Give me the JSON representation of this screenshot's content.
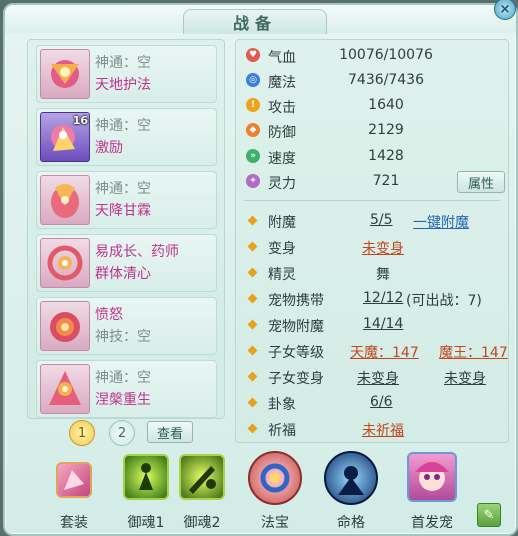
{
  "window": {
    "title": "战备",
    "close_label": "×",
    "colors": {
      "panel": "#dff1ec",
      "accent": "#e7a21a",
      "pink_text": "#c0338c",
      "red_text": "#c3461f",
      "blue_link": "#2267b3"
    }
  },
  "skills": [
    {
      "line1": "神通：空",
      "line2": "天地护法",
      "badge": "",
      "icon": "guardian-icon",
      "selected": false
    },
    {
      "line1": "神通：空",
      "line2": "激励",
      "badge": "16",
      "icon": "encourage-icon",
      "selected": true
    },
    {
      "line1": "神通：空",
      "line2": "天降甘霖",
      "badge": "",
      "icon": "rain-icon",
      "selected": false
    },
    {
      "line1": "易成长、药师",
      "line2": "群体清心",
      "badge": "",
      "icon": "cleanse-icon",
      "selected": false
    },
    {
      "line1": "愤怒",
      "line2": "神技：空",
      "badge": "",
      "icon": "rage-icon",
      "selected": false
    },
    {
      "line1": "神通：空",
      "line2": "涅槃重生",
      "badge": "",
      "icon": "rebirth-icon",
      "selected": false
    }
  ],
  "pagination": {
    "page1": "1",
    "page2": "2",
    "view_label": "查看"
  },
  "stats": [
    {
      "label": "气血",
      "value": "10076/10076",
      "icon": "heart-icon",
      "color": "#e15b4c",
      "glyph": "♥"
    },
    {
      "label": "魔法",
      "value": "7436/7436",
      "icon": "mana-icon",
      "color": "#3a7fd8",
      "glyph": "◎"
    },
    {
      "label": "攻击",
      "value": "1640",
      "icon": "attack-icon",
      "color": "#f0a21a",
      "glyph": "!"
    },
    {
      "label": "防御",
      "value": "2129",
      "icon": "shield-icon",
      "color": "#f07f2a",
      "glyph": "◆"
    },
    {
      "label": "速度",
      "value": "1428",
      "icon": "speed-icon",
      "color": "#3ab26a",
      "glyph": "»"
    },
    {
      "label": "灵力",
      "value": "721",
      "icon": "spirit-icon",
      "color": "#b06ac8",
      "glyph": "✦"
    }
  ],
  "attr_button": "属性",
  "info": {
    "fumo": {
      "label": "附魔",
      "value": "5/5",
      "action": "一键附魔"
    },
    "bianshen": {
      "label": "变身",
      "value": "未变身"
    },
    "jingling": {
      "label": "精灵",
      "value": "舞"
    },
    "pet_carry": {
      "label": "宠物携带",
      "value": "12/12",
      "note": "(可出战：7)"
    },
    "pet_enchant": {
      "label": "宠物附魔",
      "value": "14/14"
    },
    "child_level": {
      "label": "子女等级",
      "value1": "天魔：147",
      "value2": "魔王：147"
    },
    "child_transform": {
      "label": "子女变身",
      "value1": "未变身",
      "value2": "未变身"
    },
    "guaxiang": {
      "label": "卦象",
      "value": "6/6"
    },
    "qifu": {
      "label": "祈福",
      "value": "未祈福"
    }
  },
  "bottom": [
    {
      "label": "套装",
      "icon": "outfit-icon"
    },
    {
      "label": "御魂1",
      "icon": "soul1-icon"
    },
    {
      "label": "御魂2",
      "icon": "soul2-icon"
    },
    {
      "label": "法宝",
      "icon": "treasure-icon"
    },
    {
      "label": "命格",
      "icon": "destiny-icon"
    },
    {
      "label": "首发宠",
      "icon": "first-pet-icon"
    }
  ],
  "edit_label": "✎"
}
